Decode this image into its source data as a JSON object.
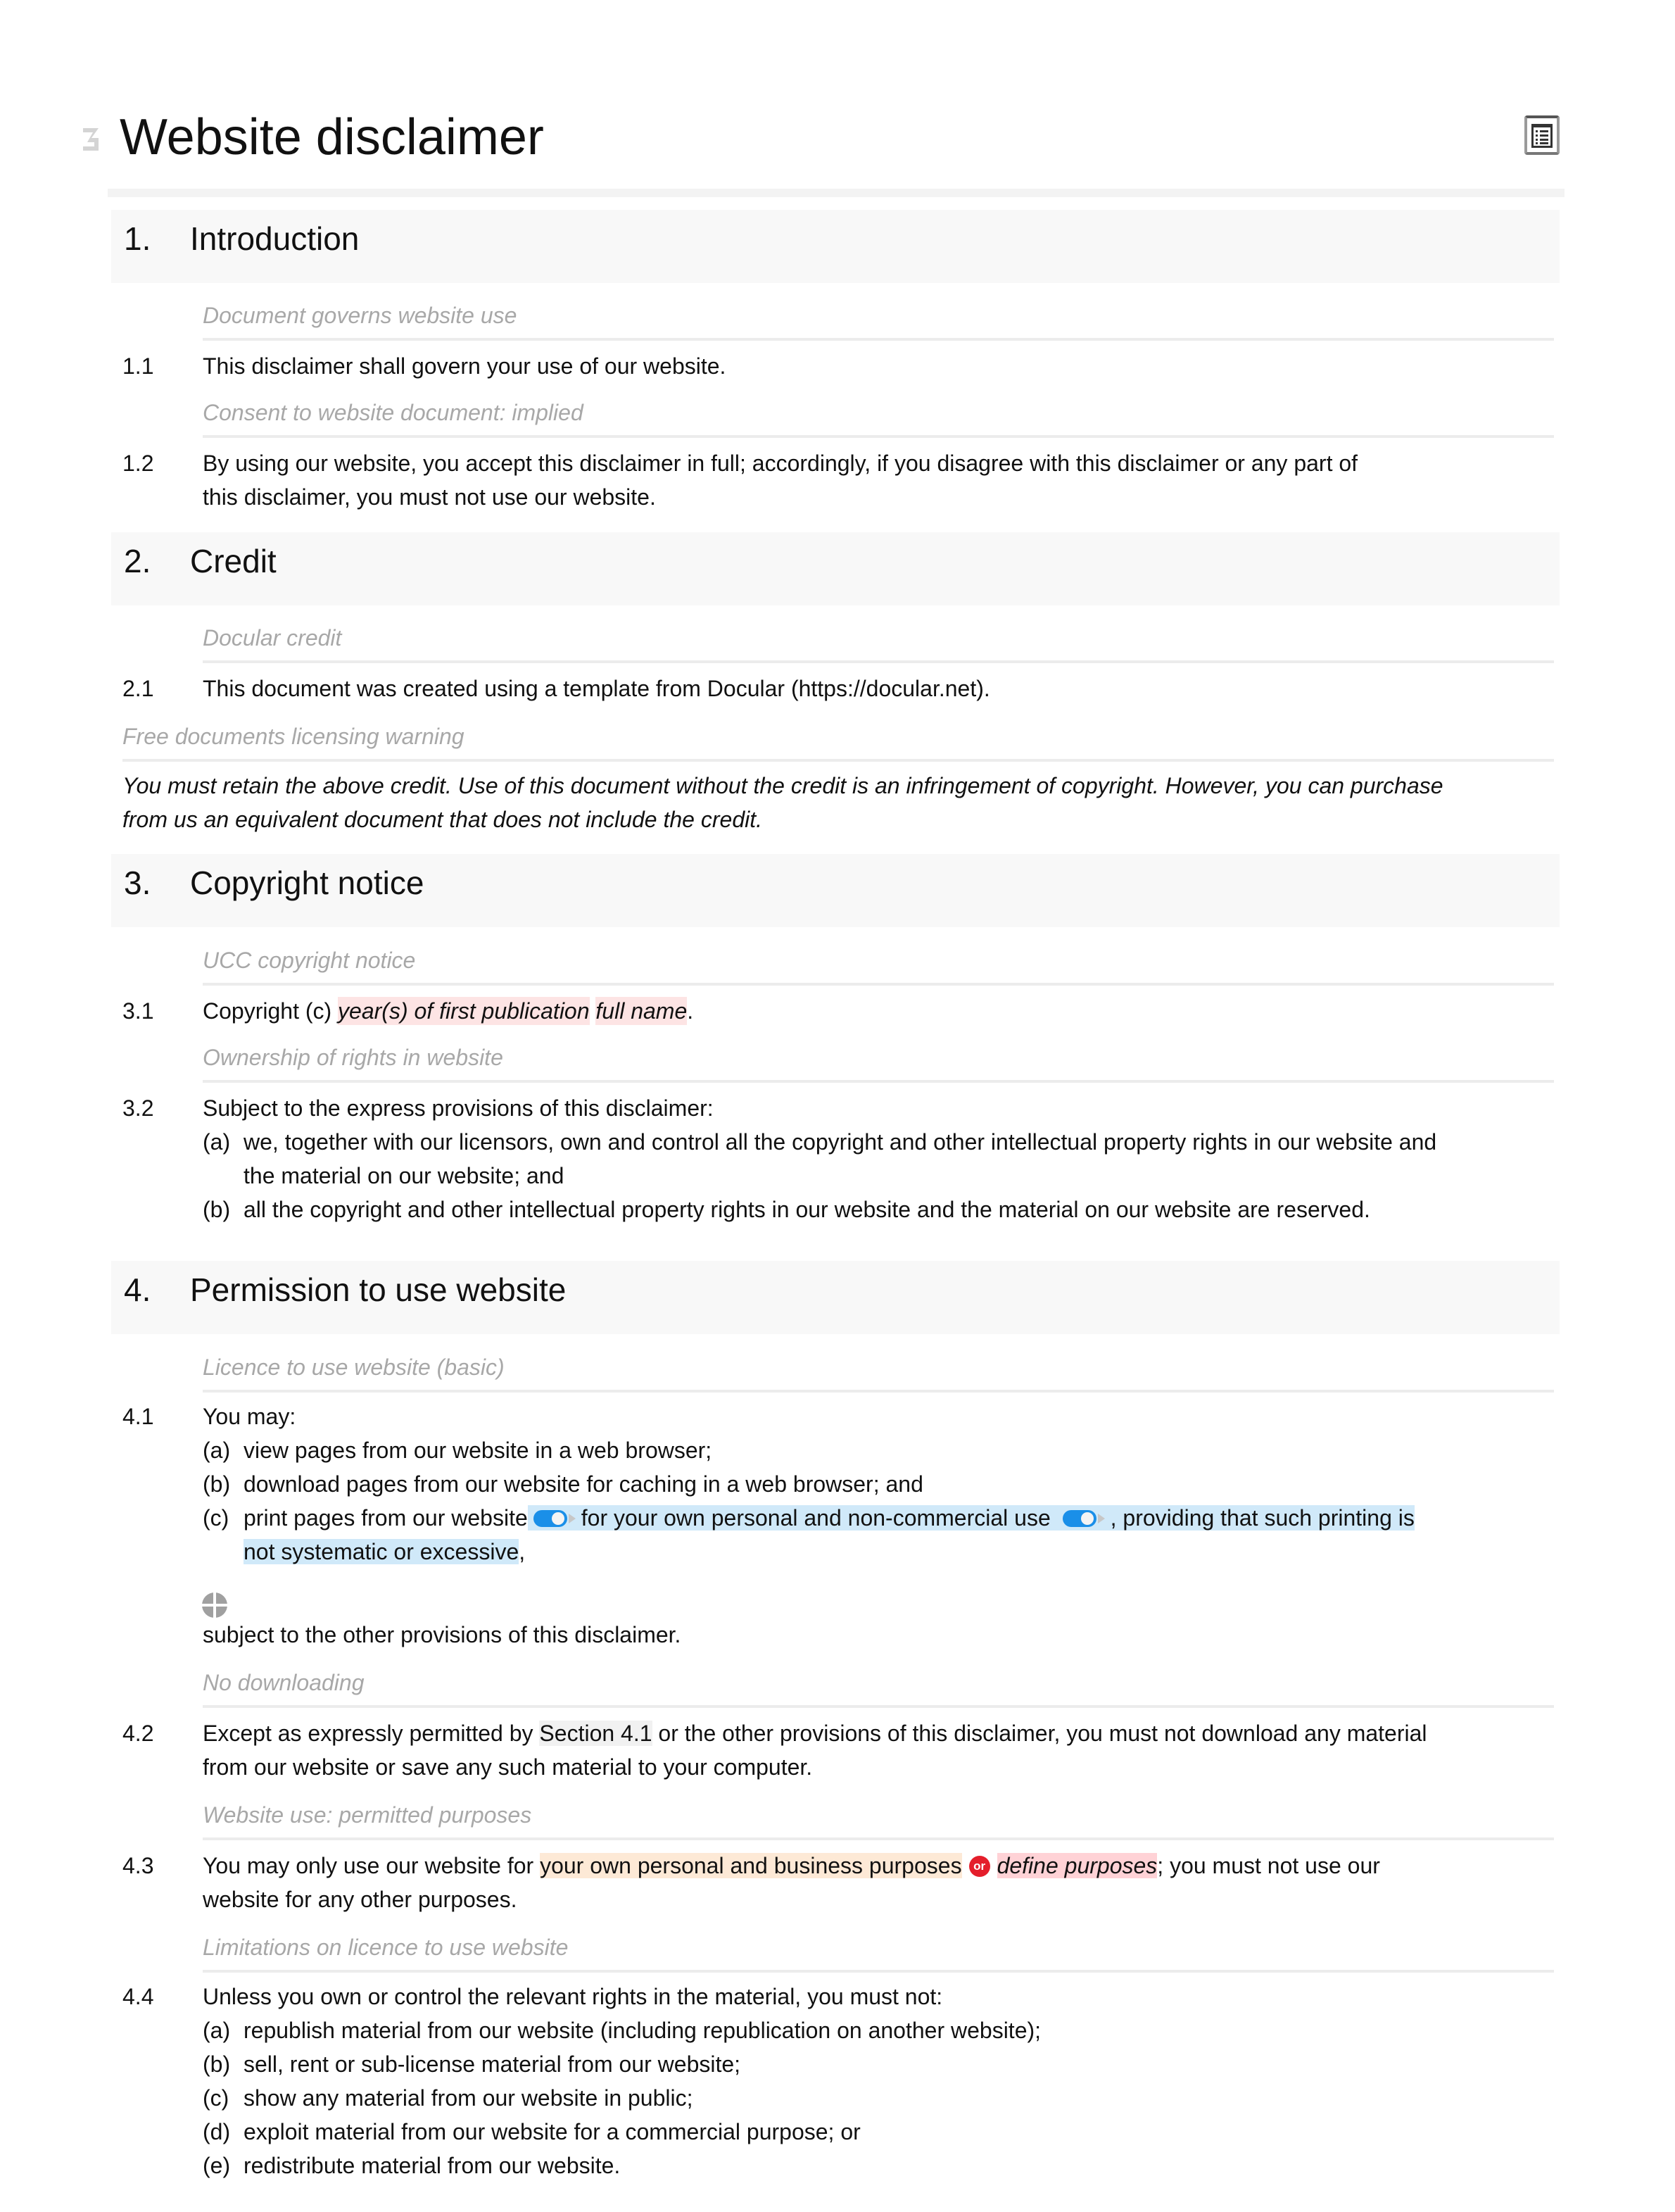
{
  "document": {
    "title": "Website disclaimer",
    "toc_button_icon": "table-of-contents-icon",
    "logo_icon": "docular-logo-icon"
  },
  "colors": {
    "section_bg": "#f8f8f8",
    "note_text": "#a8a8a8",
    "placeholder_highlight": "#fde4e4",
    "optional_highlight": "#d0e9f9",
    "alternative_highlight": "#fde9d6",
    "toggle": "#1a8fe8",
    "or_badge": "#e41e2b"
  },
  "sections": [
    {
      "number": "1.",
      "title": "Introduction",
      "clauses": [
        {
          "note": "Document governs website use",
          "number": "1.1",
          "text": "This disclaimer shall govern your use of our website."
        },
        {
          "note": "Consent to website document: implied",
          "number": "1.2",
          "line1": "By using our website, you accept this disclaimer in full; accordingly, if you disagree with this disclaimer or any part of",
          "line2": "this disclaimer, you must not use our website."
        }
      ]
    },
    {
      "number": "2.",
      "title": "Credit",
      "clauses": [
        {
          "note": "Docular credit",
          "number": "2.1",
          "text": "This document was created using a template from Docular (https://docular.net)."
        }
      ],
      "warning": {
        "note": "Free documents licensing warning",
        "line1": "You must retain the above credit. Use of this document without the credit is an infringement of copyright. However, you can purchase",
        "line2": "from us an equivalent document that does not include the credit."
      }
    },
    {
      "number": "3.",
      "title": "Copyright notice",
      "clauses": [
        {
          "note": "UCC copyright notice",
          "number": "3.1",
          "prefix": "Copyright (c) ",
          "placeholder1": "year(s) of first publication",
          "placeholder2": "full name",
          "suffix": "."
        },
        {
          "note": "Ownership of rights in website",
          "number": "3.2",
          "text": "Subject to the express provisions of this disclaimer:",
          "items": [
            {
              "label": "(a)",
              "line1": "we, together with our licensors, own and control all the copyright and other intellectual property rights in our website and",
              "line2": "the material on our website; and"
            },
            {
              "label": "(b)",
              "line1": "all the copyright and other intellectual property rights in our website and the material on our website are reserved."
            }
          ]
        }
      ]
    },
    {
      "number": "4.",
      "title": "Permission to use website",
      "clauses": [
        {
          "note": "Licence to use website (basic)",
          "number": "4.1",
          "text": "You may:",
          "items": [
            {
              "label": "(a)",
              "line1": "view pages from our website in a web browser;"
            },
            {
              "label": "(b)",
              "line1": "download pages from our website for caching in a web browser; and"
            },
            {
              "label": "(c)",
              "prefix": "print pages from our website",
              "opt1": "for your own personal and non-commercial use",
              "opt2": ", providing that such printing is",
              "opt2_line2": "not systematic or excessive",
              "suffix": ","
            }
          ],
          "add_icon": "add-element-icon",
          "trailing": "subject to the other provisions of this disclaimer."
        },
        {
          "note": "No downloading",
          "number": "4.2",
          "prefix": "Except as expressly permitted by ",
          "ref": "Section 4.1",
          "suffix": " or the other provisions of this disclaimer, you must not download any material",
          "line2": "from our website or save any such material to your computer."
        },
        {
          "note": "Website use: permitted purposes",
          "number": "4.3",
          "prefix": "You may only use our website for ",
          "alt1": "your own personal and business purposes",
          "or_label": "or",
          "alt2": "define purposes",
          "suffix": "; you must not use our",
          "line2": "website for any other purposes."
        },
        {
          "note": "Limitations on licence to use website",
          "number": "4.4",
          "text": "Unless you own or control the relevant rights in the material, you must not:",
          "items": [
            {
              "label": "(a)",
              "line1": "republish material from our website (including republication on another website);"
            },
            {
              "label": "(b)",
              "line1": "sell, rent or sub-license material from our website;"
            },
            {
              "label": "(c)",
              "line1": "show any material from our website in public;"
            },
            {
              "label": "(d)",
              "line1": "exploit material from our website for a commercial purpose; or"
            },
            {
              "label": "(e)",
              "line1": "redistribute material from our website."
            }
          ]
        }
      ]
    }
  ]
}
